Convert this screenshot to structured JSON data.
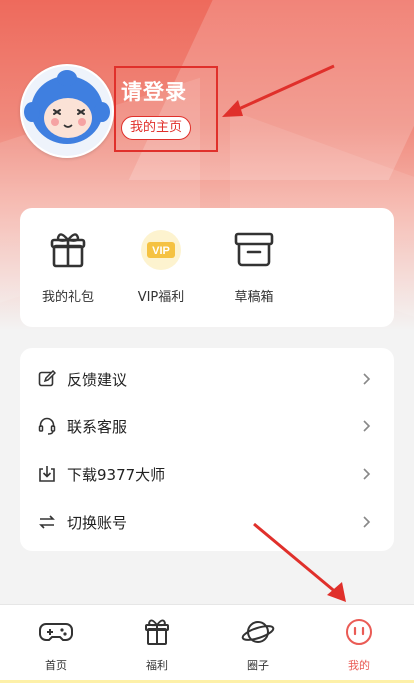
{
  "profile": {
    "title": "请登录",
    "homepage_label": "我的主页"
  },
  "quick_actions": [
    {
      "label": "我的礼包",
      "icon": "gift-icon"
    },
    {
      "label": "VIP福利",
      "icon": "vip-badge-icon",
      "badge_text": "VIP"
    },
    {
      "label": "草稿箱",
      "icon": "draft-box-icon"
    }
  ],
  "menu": [
    {
      "label": "反馈建议",
      "icon": "edit-icon"
    },
    {
      "label": "联系客服",
      "icon": "customer-service-icon"
    },
    {
      "label": "下载9377大师",
      "icon": "download-icon"
    },
    {
      "label": "切换账号",
      "icon": "switch-icon"
    }
  ],
  "tabs": [
    {
      "label": "首页",
      "icon": "gamepad-icon"
    },
    {
      "label": "福利",
      "icon": "gift-icon"
    },
    {
      "label": "圈子",
      "icon": "planet-icon"
    },
    {
      "label": "我的",
      "icon": "smile-icon",
      "active": true
    }
  ],
  "colors": {
    "accent": "#ea5b55",
    "annotation": "#e0302b",
    "vip": "#f5c242"
  }
}
